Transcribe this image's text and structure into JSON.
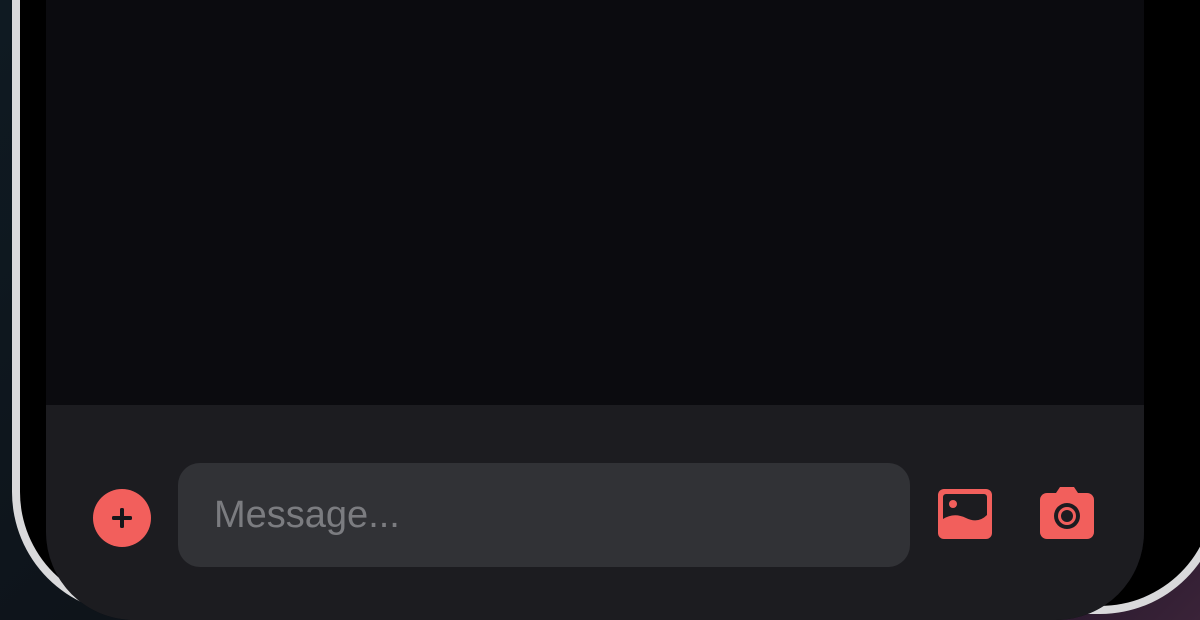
{
  "composer": {
    "input_placeholder": "Message...",
    "input_value": ""
  },
  "icons": {
    "add": "plus-icon",
    "gallery": "image-icon",
    "camera": "camera-icon"
  },
  "colors": {
    "accent": "#f25f5c",
    "screen_background": "#0b0b0f",
    "composer_background": "#1c1c20",
    "input_background": "#313236",
    "placeholder": "#7b7c80"
  }
}
